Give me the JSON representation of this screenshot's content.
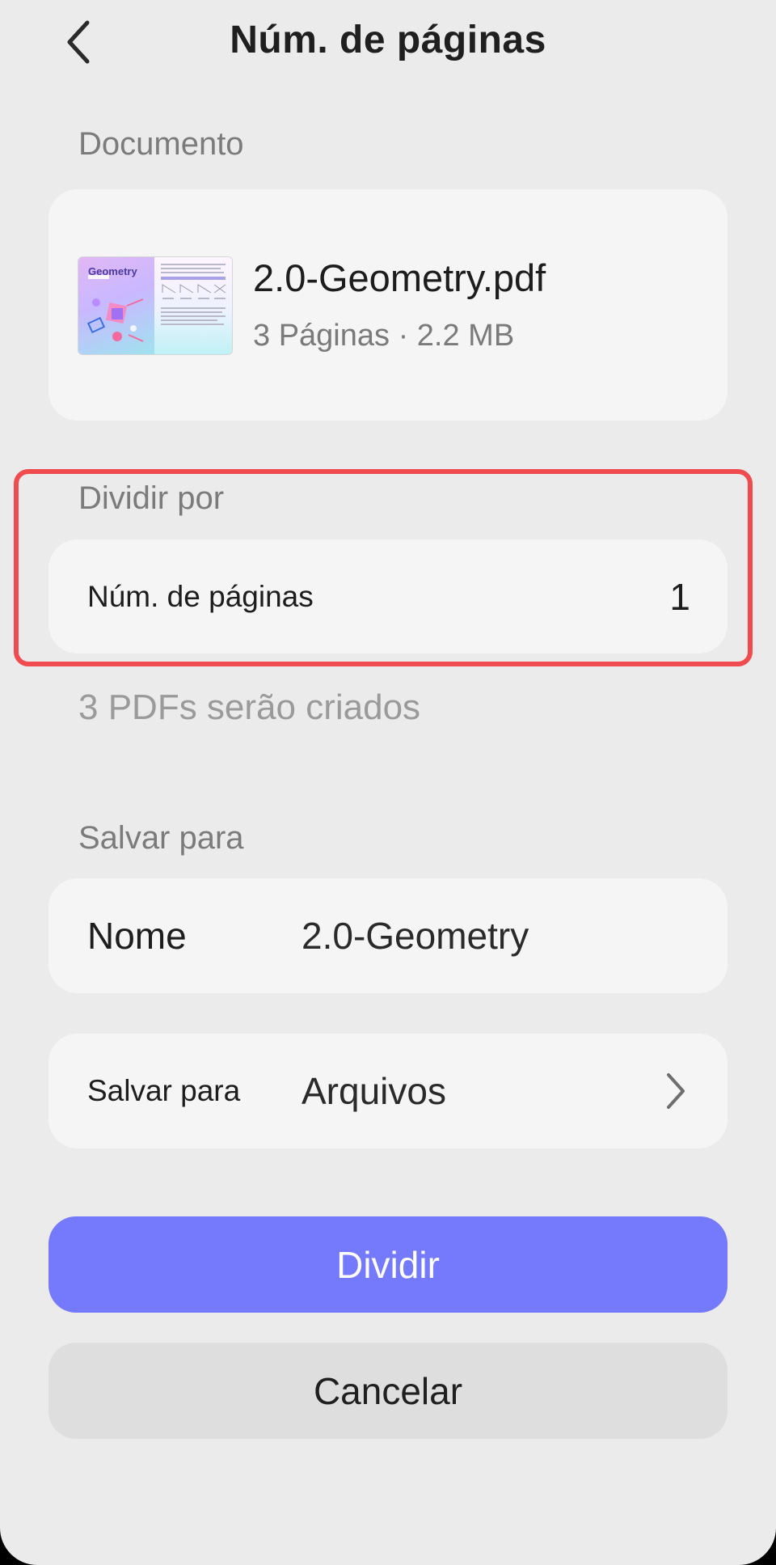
{
  "header": {
    "title": "Núm. de páginas",
    "back_icon": "chevron-left-icon"
  },
  "document_section": {
    "label": "Documento",
    "file_name": "2.0-Geometry.pdf",
    "meta": "3 Páginas · 2.2 MB",
    "thumbnail_title": "Geometry"
  },
  "split_section": {
    "label": "Dividir por",
    "row_label": "Núm. de páginas",
    "row_value": "1",
    "hint": "3 PDFs serão criados",
    "highlight_color": "#f04b4f"
  },
  "save_section": {
    "label": "Salvar para",
    "name_label": "Nome",
    "name_value": "2.0-Geometry",
    "destination_label": "Salvar para",
    "destination_value": "Arquivos",
    "destination_icon": "chevron-right-icon"
  },
  "actions": {
    "primary_label": "Dividir",
    "secondary_label": "Cancelar"
  },
  "colors": {
    "background": "#ebebeb",
    "card": "#f5f5f5",
    "primary": "#7579fc",
    "secondary": "#dedede",
    "highlight": "#f04b4f"
  }
}
